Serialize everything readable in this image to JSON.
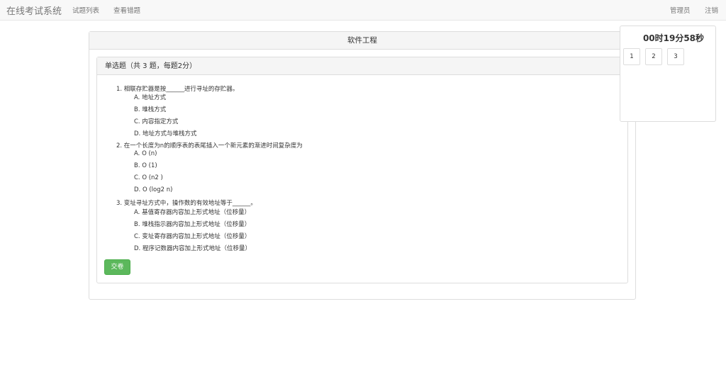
{
  "navbar": {
    "brand": "在线考试系统",
    "links": [
      "试题列表",
      "查看错题"
    ],
    "right_links": [
      "管理员",
      "注销"
    ]
  },
  "exam": {
    "title": "软件工程",
    "section_title": "单选题（共 3 题，每题2分）",
    "questions": [
      {
        "text": "1. 相联存贮器是按______进行寻址的存贮器。",
        "options": [
          "A. 地址方式",
          "B. 堆栈方式",
          "C. 内容指定方式",
          "D. 地址方式与堆栈方式"
        ]
      },
      {
        "text": "2. 在一个长度为n的顺序表的表尾插入一个新元素的渐进时间复杂度为",
        "options": [
          "A. O (n)",
          "B. O (1)",
          "C. O (n2 )",
          "D. O (log2 n)"
        ]
      },
      {
        "text": "3. 变址寻址方式中，操作数的有效地址等于______。",
        "options": [
          "A. 基值寄存器内容加上形式地址（位移量）",
          "B. 堆栈指示器内容加上形式地址（位移量）",
          "C. 变址寄存器内容加上形式地址（位移量）",
          "D. 程序记数器内容加上形式地址（位移量）"
        ]
      }
    ],
    "submit_label": "交卷"
  },
  "timer": {
    "remaining": "00时19分58秒",
    "question_numbers": [
      "1",
      "2",
      "3"
    ]
  },
  "colors": {
    "submit_green": "#5cb85c",
    "navbar_bg": "#f8f8f8"
  }
}
